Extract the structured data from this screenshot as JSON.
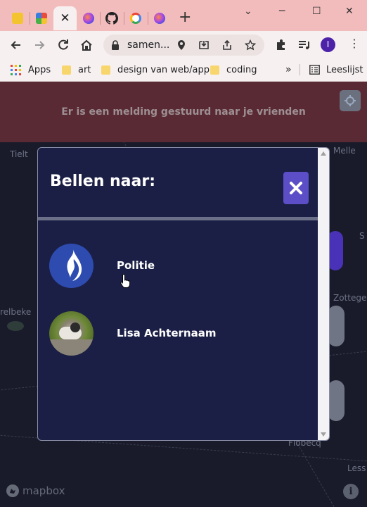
{
  "browser": {
    "tabs": [
      {
        "icon": "yellow-app-icon",
        "color": "#f4c430"
      },
      {
        "icon": "colorful-app-icon",
        "color": "#e98a3c"
      },
      {
        "icon": "close-icon",
        "active": true
      },
      {
        "icon": "firefox-icon",
        "color": "#5a5fe0"
      },
      {
        "icon": "github-icon",
        "color": "#222222"
      },
      {
        "icon": "google-icon",
        "color": "#4285f4"
      },
      {
        "icon": "firefox-icon",
        "color": "#5a5fe0"
      }
    ],
    "address": "samen...",
    "profile_initial": "I",
    "bookmarks": {
      "apps": "Apps",
      "items": [
        "art",
        "design van web/app",
        "coding"
      ],
      "more": "»",
      "reading_list": "Leeslijst"
    }
  },
  "page": {
    "banner_text": "Er is een melding gestuurd naar je vrienden",
    "map_labels": {
      "tielt": "Tielt",
      "melle": "Melle",
      "zottegem": "Zottegem",
      "waregem_partial": "relbeke",
      "right_partial": "S",
      "lessines_partial": "Less",
      "bottom_partial": "Flobecq"
    },
    "mapbox_label": "mapbox",
    "info_label": "i"
  },
  "modal": {
    "title": "Bellen naar:",
    "close_label": "✖",
    "contacts": [
      {
        "name": "Politie",
        "avatar": "police-flame-logo"
      },
      {
        "name": "Lisa Achternaam",
        "avatar": "dog-photo"
      }
    ]
  },
  "colors": {
    "tabstrip": "#f3bcbc",
    "banner": "#5a2a34",
    "modal_bg": "#1b1f45",
    "close_button": "#5b4ec7",
    "police_blue": "#2e4bb0"
  }
}
